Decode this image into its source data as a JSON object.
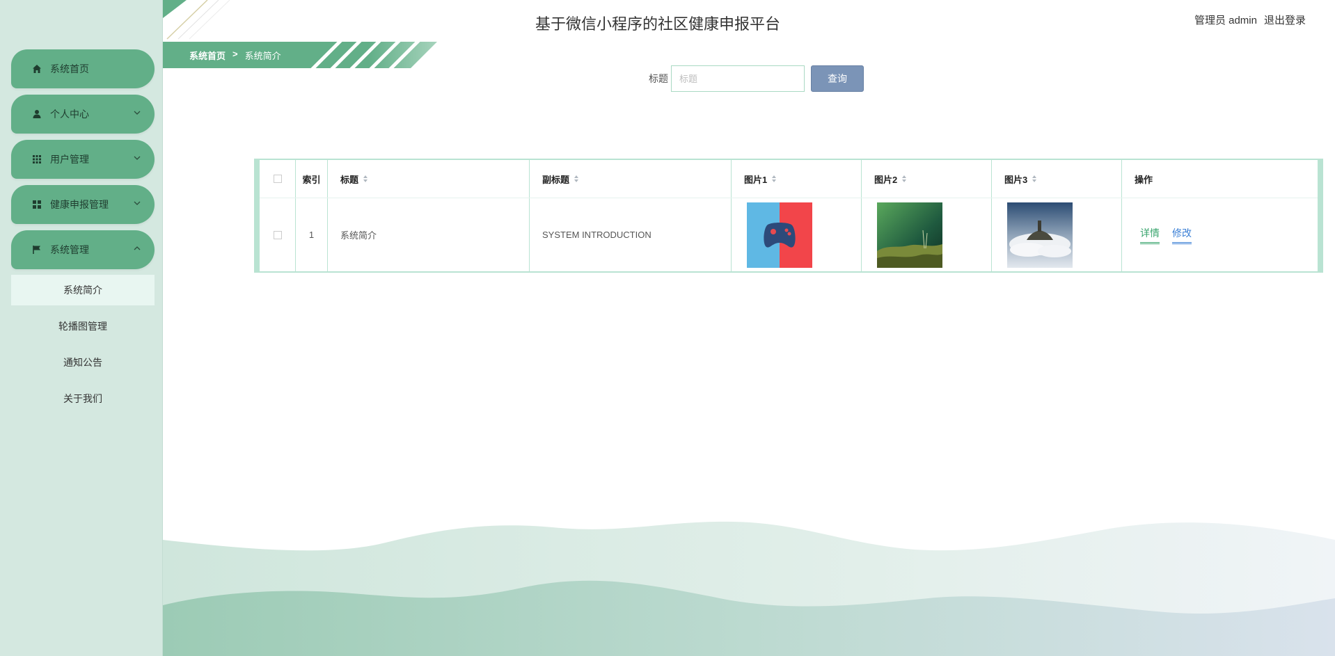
{
  "app": {
    "title": "基于微信小程序的社区健康申报平台",
    "user_label": "管理员 admin",
    "logout_label": "退出登录"
  },
  "sidebar": {
    "items": [
      {
        "label": "系统首页",
        "icon": "home-icon"
      },
      {
        "label": "个人中心",
        "icon": "user-icon"
      },
      {
        "label": "用户管理",
        "icon": "grid-icon"
      },
      {
        "label": "健康申报管理",
        "icon": "apps-icon"
      },
      {
        "label": "系统管理",
        "icon": "flag-icon"
      }
    ],
    "submenu": [
      {
        "label": "系统简介",
        "active": true
      },
      {
        "label": "轮播图管理"
      },
      {
        "label": "通知公告"
      },
      {
        "label": "关于我们"
      }
    ]
  },
  "breadcrumb": {
    "home": "系统首页",
    "separator": ">",
    "current": "系统简介"
  },
  "search": {
    "label": "标题",
    "placeholder": "标题",
    "button": "查询"
  },
  "table": {
    "headers": {
      "index": "索引",
      "title": "标题",
      "subtitle": "副标题",
      "img1": "图片1",
      "img2": "图片2",
      "img3": "图片3",
      "ops": "操作"
    },
    "rows": [
      {
        "index": "1",
        "title": "系统简介",
        "subtitle": "SYSTEM INTRODUCTION",
        "detail": "详情",
        "edit": "修改"
      }
    ]
  },
  "colors": {
    "accent": "#62af88",
    "sidebar_bg": "#d4e8e0",
    "search_button": "#7b94b7"
  }
}
